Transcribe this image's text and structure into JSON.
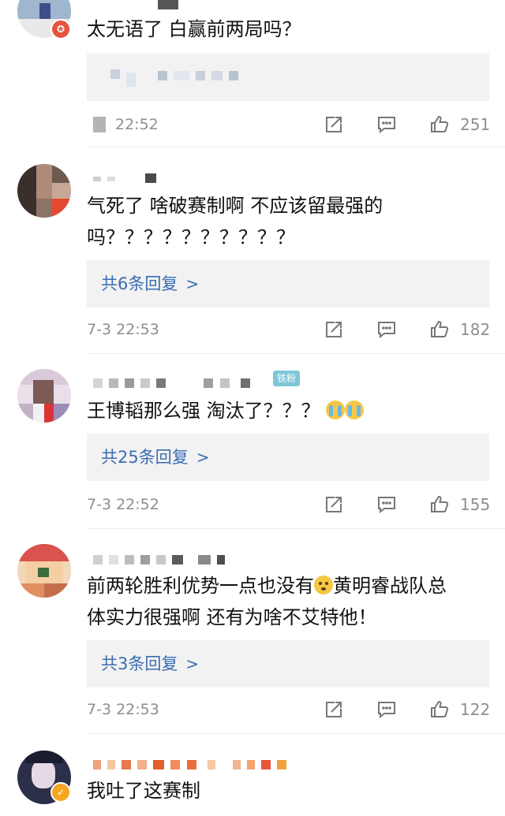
{
  "comments": [
    {
      "text": "太无语了 白赢前两局吗？",
      "time": "22:52",
      "likes": "251"
    },
    {
      "text_line1": "气死了 啥破赛制啊 不应该留最强的",
      "text_line2": "吗？？？？？？？？？？",
      "reply_label": "共6条回复",
      "time": "7-3 22:53",
      "likes": "182"
    },
    {
      "badge": "铁粉",
      "text": "王博韬那么强 淘汰了？？？",
      "reply_label": "共25条回复",
      "time": "7-3 22:52",
      "likes": "155"
    },
    {
      "text_line1a": "前两轮胜利优势一点也没有",
      "text_line1b": "黄明睿战队总",
      "text_line2": "体实力很强啊 还有为啥不艾特他！",
      "reply_label": "共3条回复",
      "time": "7-3 22:53",
      "likes": "122"
    },
    {
      "text": "我吐了这赛制"
    }
  ],
  "icons": {
    "share": "share-icon",
    "comment": "comment-icon",
    "like": "thumbs-up-icon",
    "chevron": "chevron-right-icon",
    "crying_emoji": "crying-emoji-icon",
    "thinking_emoji": "thinking-emoji-icon"
  },
  "colors": {
    "link": "#3a6cb3",
    "meta_gray": "#8e8e8e",
    "reply_bg": "#f2f2f2",
    "verified_orange": "#f5a623",
    "verified_red": "#e5533d",
    "fan_badge": "#7ec6d8"
  }
}
